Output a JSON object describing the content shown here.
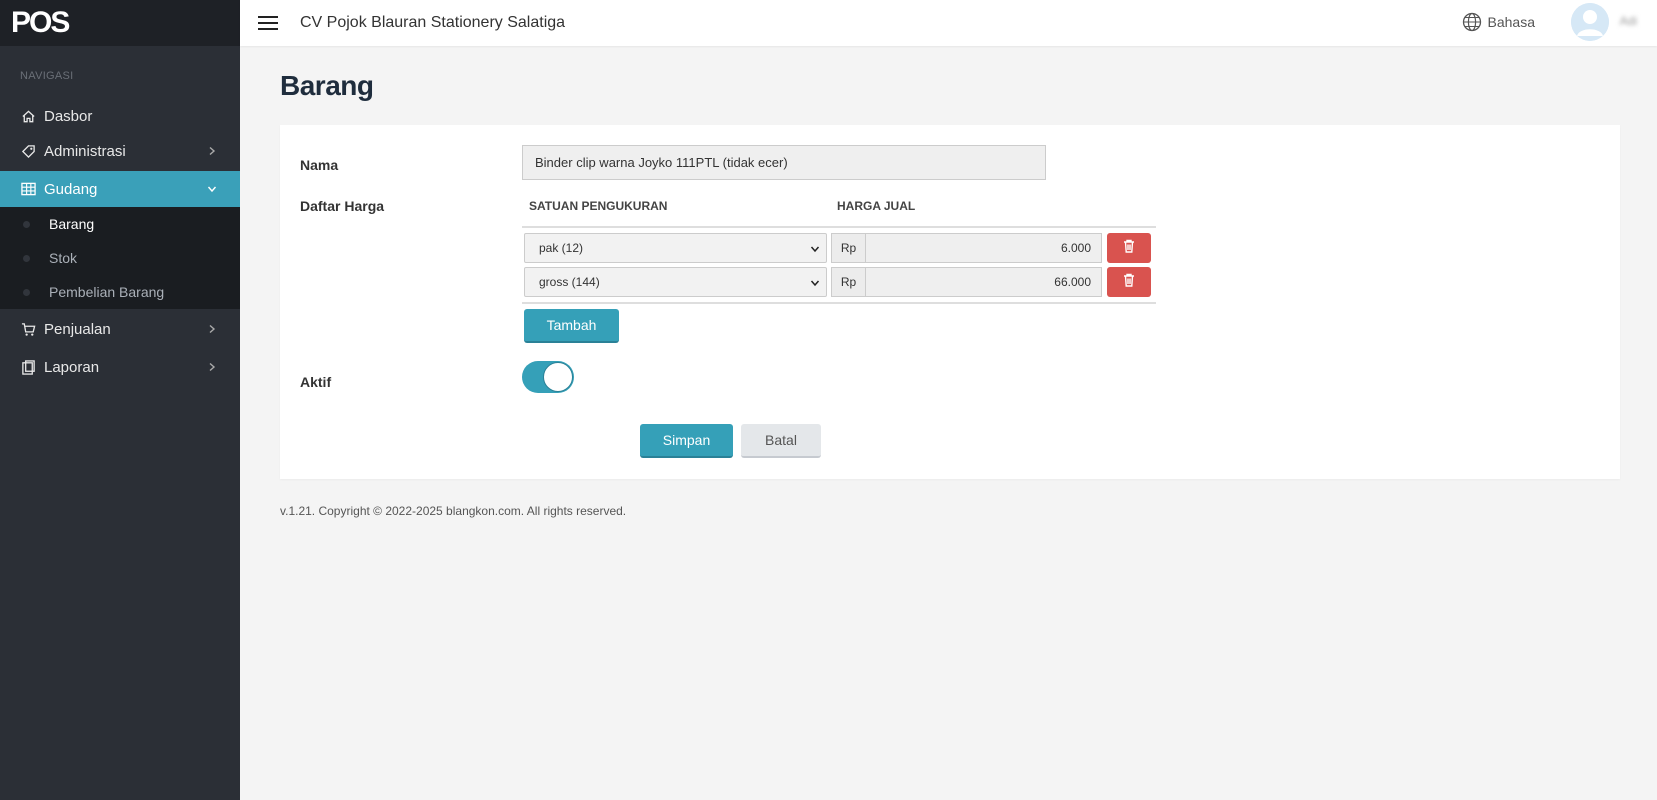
{
  "brand": "POS",
  "header": {
    "title": "CV Pojok Blauran Stationery Salatiga",
    "language_label": "Bahasa",
    "user_name": "Adi"
  },
  "sidebar": {
    "heading": "NAVIGASI",
    "items": [
      {
        "label": "Dasbor",
        "icon": "home-icon"
      },
      {
        "label": "Administrasi",
        "icon": "tag-icon"
      },
      {
        "label": "Gudang",
        "icon": "table-icon"
      },
      {
        "label": "Penjualan",
        "icon": "cart-icon"
      },
      {
        "label": "Laporan",
        "icon": "clipboard-icon"
      }
    ],
    "gudang_submenu": [
      {
        "label": "Barang"
      },
      {
        "label": "Stok"
      },
      {
        "label": "Pembelian Barang"
      }
    ],
    "accent_color": "#3aa0b9"
  },
  "main": {
    "page_title": "Barang",
    "form": {
      "name_label": "Nama",
      "name_value": "Binder clip warna Joyko 111PTL (tidak ecer)",
      "price_list_label": "Daftar Harga",
      "col_unit": "SATUAN PENGUKURAN",
      "col_price": "HARGA JUAL",
      "rows": [
        {
          "unit": "pak (12)",
          "currency": "Rp",
          "price": "6.000"
        },
        {
          "unit": "gross (144)",
          "currency": "Rp",
          "price": "66.000"
        }
      ],
      "add_button": "Tambah",
      "active_label": "Aktif",
      "active_value": true,
      "save_button": "Simpan",
      "cancel_button": "Batal"
    }
  },
  "footer": {
    "text": "v.1.21. Copyright © 2022-2025 blangkon.com. All rights reserved."
  }
}
